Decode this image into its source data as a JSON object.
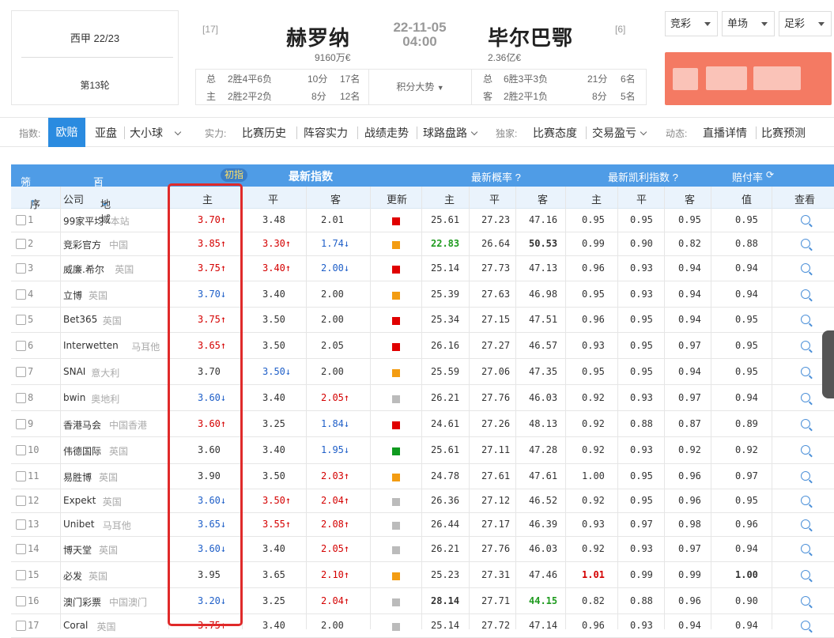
{
  "match": {
    "league": "西甲 22/23",
    "round": "第13轮",
    "home": {
      "name": "赫罗纳",
      "rank": "[17]",
      "value": "9160万€"
    },
    "away": {
      "name": "毕尔巴鄂",
      "rank": "[6]",
      "value": "2.36亿€"
    },
    "date": "22-11-05",
    "time": "04:00",
    "home_stats": [
      {
        "label": "总",
        "record": "2胜4平6负",
        "points": "10分",
        "pos": "17名"
      },
      {
        "label": "主",
        "record": "2胜2平2负",
        "points": "8分",
        "pos": "12名"
      }
    ],
    "away_stats": [
      {
        "label": "总",
        "record": "6胜3平3负",
        "points": "21分",
        "pos": "6名"
      },
      {
        "label": "客",
        "record": "2胜2平1负",
        "points": "8分",
        "pos": "5名"
      }
    ],
    "trend_label": "积分大势"
  },
  "selects": [
    {
      "label": "竞彩"
    },
    {
      "label": "单场"
    },
    {
      "label": "足彩"
    }
  ],
  "nav": {
    "label_index": "指数:",
    "tab_europe": "欧赔",
    "tab_asia": "亚盘",
    "tab_ou": "大小球",
    "label_strength": "实力:",
    "history": "比赛历史",
    "squad": "阵容实力",
    "form": "战绩走势",
    "road": "球路盘路",
    "label_exclusive": "独家:",
    "attitude": "比赛态度",
    "trade": "交易盈亏",
    "label_live": "动态:",
    "live": "直播详情",
    "predict": "比赛预测"
  },
  "table": {
    "filter": "筛选",
    "companies": "百家欧指",
    "initial": "初指",
    "latest_index": "最新指数",
    "latest_prob": "最新概率 ?",
    "latest_kelly": "最新凯利指数 ?",
    "payout": "赔付率",
    "columns": {
      "seq": "序",
      "company": "公司",
      "region": "地域",
      "home": "主",
      "draw": "平",
      "away": "客",
      "update": "更新",
      "p_home": "主",
      "p_draw": "平",
      "p_away": "客",
      "k_home": "主",
      "k_draw": "平",
      "k_away": "客",
      "value": "值",
      "view": "查看"
    },
    "colors": {
      "red": "#e00000",
      "orange": "#f39c12",
      "gray": "#bbbbbb",
      "green": "#0f9a1f"
    },
    "rows": [
      {
        "no": "1",
        "company": "99家平均",
        "region": "本站",
        "home": "3.70↑",
        "hc": "red",
        "draw": "3.48",
        "dc": "black",
        "away": "2.01",
        "ac": "black",
        "upd": "red",
        "ph": "25.61",
        "pd": "27.23",
        "pa": "47.16",
        "kh": "0.95",
        "kd": "0.95",
        "ka": "0.95",
        "val": "0.95"
      },
      {
        "no": "2",
        "company": "竞彩官方",
        "region": "中国",
        "home": "3.85↑",
        "hc": "red",
        "draw": "3.30↑",
        "dc": "red",
        "away": "1.74↓",
        "ac": "blue",
        "upd": "orange",
        "ph": "22.83",
        "phc": "green",
        "pd": "26.64",
        "pa": "50.53",
        "pac": "bold",
        "kh": "0.99",
        "kd": "0.90",
        "ka": "0.82",
        "val": "0.88"
      },
      {
        "no": "3",
        "company": "威廉.希尔",
        "region": "英国",
        "home": "3.75↑",
        "hc": "red",
        "draw": "3.40↑",
        "dc": "red",
        "away": "2.00↓",
        "ac": "blue",
        "upd": "red",
        "ph": "25.14",
        "pd": "27.73",
        "pa": "47.13",
        "kh": "0.96",
        "kd": "0.93",
        "ka": "0.94",
        "val": "0.94"
      },
      {
        "no": "4",
        "company": "立博",
        "region": "英国",
        "home": "3.70↓",
        "hc": "blue",
        "draw": "3.40",
        "dc": "black",
        "away": "2.00",
        "ac": "black",
        "upd": "orange",
        "ph": "25.39",
        "pd": "27.63",
        "pa": "46.98",
        "kh": "0.95",
        "kd": "0.93",
        "ka": "0.94",
        "val": "0.94"
      },
      {
        "no": "5",
        "company": "Bet365",
        "region": "英国",
        "home": "3.75↑",
        "hc": "red",
        "draw": "3.50",
        "dc": "black",
        "away": "2.00",
        "ac": "black",
        "upd": "red",
        "ph": "25.34",
        "pd": "27.15",
        "pa": "47.51",
        "kh": "0.96",
        "kd": "0.95",
        "ka": "0.94",
        "val": "0.95"
      },
      {
        "no": "6",
        "company": "Interwetten",
        "region": "马耳他",
        "home": "3.65↑",
        "hc": "red",
        "draw": "3.50",
        "dc": "black",
        "away": "2.05",
        "ac": "black",
        "upd": "red",
        "ph": "26.16",
        "pd": "27.27",
        "pa": "46.57",
        "kh": "0.93",
        "kd": "0.95",
        "ka": "0.97",
        "val": "0.95"
      },
      {
        "no": "7",
        "company": "SNAI",
        "region": "意大利",
        "home": "3.70",
        "hc": "black",
        "draw": "3.50↓",
        "dc": "blue",
        "away": "2.00",
        "ac": "black",
        "upd": "orange",
        "ph": "25.59",
        "pd": "27.06",
        "pa": "47.35",
        "kh": "0.95",
        "kd": "0.95",
        "ka": "0.94",
        "val": "0.95"
      },
      {
        "no": "8",
        "company": "bwin",
        "region": "奥地利",
        "home": "3.60↓",
        "hc": "blue",
        "draw": "3.40",
        "dc": "black",
        "away": "2.05↑",
        "ac": "red",
        "upd": "gray",
        "ph": "26.21",
        "pd": "27.76",
        "pa": "46.03",
        "kh": "0.92",
        "kd": "0.93",
        "ka": "0.97",
        "val": "0.94"
      },
      {
        "no": "9",
        "company": "香港马会",
        "region": "中国香港",
        "home": "3.60↑",
        "hc": "red",
        "draw": "3.25",
        "dc": "black",
        "away": "1.84↓",
        "ac": "blue",
        "upd": "red",
        "ph": "24.61",
        "pd": "27.26",
        "pa": "48.13",
        "kh": "0.92",
        "kd": "0.88",
        "ka": "0.87",
        "val": "0.89"
      },
      {
        "no": "10",
        "company": "伟德国际",
        "region": "英国",
        "home": "3.60",
        "hc": "black",
        "draw": "3.40",
        "dc": "black",
        "away": "1.95↓",
        "ac": "blue",
        "upd": "green",
        "ph": "25.61",
        "pd": "27.11",
        "pa": "47.28",
        "kh": "0.92",
        "kd": "0.93",
        "ka": "0.92",
        "val": "0.92"
      },
      {
        "no": "11",
        "company": "易胜博",
        "region": "英国",
        "home": "3.90",
        "hc": "black",
        "draw": "3.50",
        "dc": "black",
        "away": "2.03↑",
        "ac": "red",
        "upd": "orange",
        "ph": "24.78",
        "pd": "27.61",
        "pa": "47.61",
        "kh": "1.00",
        "kd": "0.95",
        "ka": "0.96",
        "val": "0.97"
      },
      {
        "no": "12",
        "company": "Expekt",
        "region": "英国",
        "home": "3.60↓",
        "hc": "blue",
        "draw": "3.50↑",
        "dc": "red",
        "away": "2.04↑",
        "ac": "red",
        "upd": "gray",
        "ph": "26.36",
        "pd": "27.12",
        "pa": "46.52",
        "kh": "0.92",
        "kd": "0.95",
        "ka": "0.96",
        "val": "0.95"
      },
      {
        "no": "13",
        "company": "Unibet",
        "region": "马耳他",
        "home": "3.65↓",
        "hc": "blue",
        "draw": "3.55↑",
        "dc": "red",
        "away": "2.08↑",
        "ac": "red",
        "upd": "gray",
        "ph": "26.44",
        "pd": "27.17",
        "pa": "46.39",
        "kh": "0.93",
        "kd": "0.97",
        "ka": "0.98",
        "val": "0.96"
      },
      {
        "no": "14",
        "company": "博天堂",
        "region": "英国",
        "home": "3.60↓",
        "hc": "blue",
        "draw": "3.40",
        "dc": "black",
        "away": "2.05↑",
        "ac": "red",
        "upd": "gray",
        "ph": "26.21",
        "pd": "27.76",
        "pa": "46.03",
        "kh": "0.92",
        "kd": "0.93",
        "ka": "0.97",
        "val": "0.94"
      },
      {
        "no": "15",
        "company": "必发",
        "region": "英国",
        "home": "3.95",
        "hc": "black",
        "draw": "3.65",
        "dc": "black",
        "away": "2.10↑",
        "ac": "red",
        "upd": "orange",
        "ph": "25.23",
        "pd": "27.31",
        "pa": "47.46",
        "kh": "1.01",
        "khc": "redbold",
        "kd": "0.99",
        "ka": "0.99",
        "val": "1.00",
        "valc": "bold"
      },
      {
        "no": "16",
        "company": "澳门彩票",
        "region": "中国澳门",
        "home": "3.20↓",
        "hc": "blue",
        "draw": "3.25",
        "dc": "black",
        "away": "2.04↑",
        "ac": "red",
        "upd": "gray",
        "ph": "28.14",
        "phc": "bold",
        "pd": "27.71",
        "pa": "44.15",
        "pac": "green",
        "kh": "0.82",
        "kd": "0.88",
        "ka": "0.96",
        "val": "0.90"
      },
      {
        "no": "17",
        "company": "Coral",
        "region": "英国",
        "home": "3.75↑",
        "hc": "red",
        "draw": "3.40",
        "dc": "black",
        "away": "2.00",
        "ac": "black",
        "upd": "gray",
        "ph": "25.14",
        "pd": "27.72",
        "pa": "47.14",
        "kh": "0.96",
        "kd": "0.93",
        "ka": "0.94",
        "val": "0.94"
      }
    ]
  }
}
